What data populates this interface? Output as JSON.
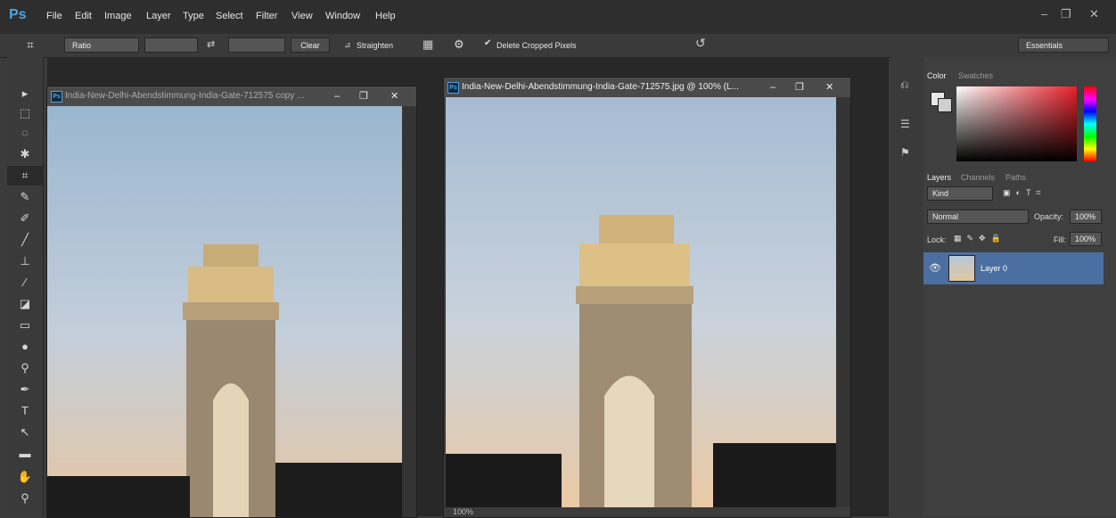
{
  "app": {
    "logo": "Ps"
  },
  "menu": [
    "File",
    "Edit",
    "Image",
    "Layer",
    "Type",
    "Select",
    "Filter",
    "View",
    "Window",
    "Help"
  ],
  "window_controls": {
    "minimize": "–",
    "restore": "❐",
    "close": "✕"
  },
  "options": {
    "ratio_value": "Ratio",
    "clear_label": "Clear",
    "straighten_label": "Straighten",
    "delete_cropped_label": "Delete Cropped Pixels",
    "delete_cropped_checked": true,
    "workspace_preset": "Essentials"
  },
  "documents": [
    {
      "title": "India-New-Delhi-Abendstimmung-India-Gate-712575 copy ...",
      "active": false
    },
    {
      "title": "India-New-Delhi-Abendstimmung-India-Gate-712575.jpg @ 100% (L...",
      "active": true,
      "status": "100%"
    }
  ],
  "panels": {
    "color_tabs": [
      "Color",
      "Swatches"
    ],
    "layers_tabs": [
      "Layers",
      "Channels",
      "Paths"
    ],
    "kind_label": "Kind",
    "blend_mode": "Normal",
    "opacity_label": "Opacity:",
    "opacity_value": "100%",
    "lock_label": "Lock:",
    "fill_label": "Fill:",
    "fill_value": "100%",
    "layers": [
      {
        "name": "Layer 0",
        "visible": true
      }
    ]
  },
  "colors": {
    "accent": "#4fa3e0",
    "selected_layer": "#4b6fa0"
  }
}
